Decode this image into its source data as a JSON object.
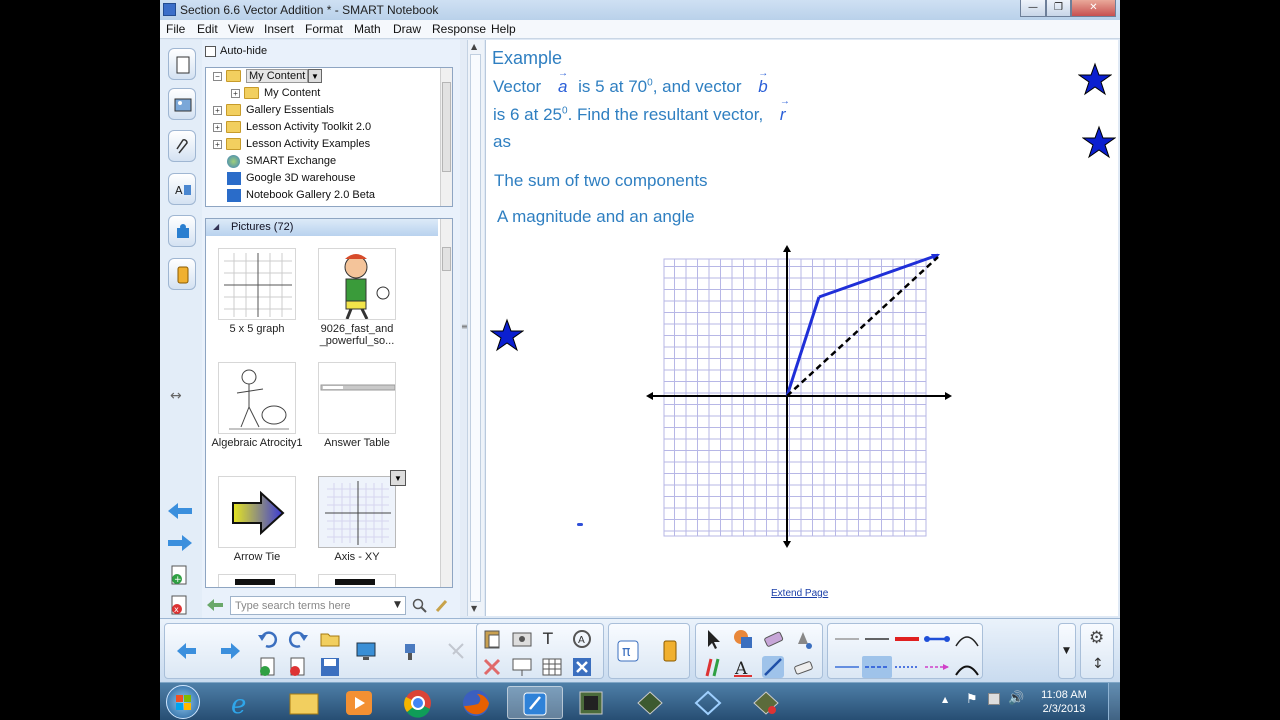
{
  "window": {
    "title": "Section 6.6 Vector Addition * - SMART Notebook",
    "minimize": "—",
    "maximize": "❐",
    "close": "✕"
  },
  "menu": [
    "File",
    "Edit",
    "View",
    "Insert",
    "Format",
    "Math",
    "Draw",
    "Response",
    "Help"
  ],
  "gallery": {
    "autohide_label": "Auto-hide",
    "tree": [
      {
        "label": "My Content",
        "level": 0,
        "expander": "−",
        "selected": true
      },
      {
        "label": "My Content",
        "level": 1,
        "expander": "+"
      },
      {
        "label": "Gallery Essentials",
        "level": 0,
        "expander": "+"
      },
      {
        "label": "Lesson Activity Toolkit 2.0",
        "level": 0,
        "expander": "+"
      },
      {
        "label": "Lesson Activity Examples",
        "level": 0,
        "expander": "+"
      },
      {
        "label": "SMART Exchange",
        "level": 0,
        "expander": ""
      },
      {
        "label": "Google 3D warehouse",
        "level": 0,
        "expander": ""
      },
      {
        "label": "Notebook Gallery 2.0 Beta",
        "level": 0,
        "expander": ""
      }
    ],
    "pictures_header": "Pictures (72)",
    "thumbnails": [
      {
        "caption": "5 x 5 graph"
      },
      {
        "caption": "9026_fast_and _powerful_so..."
      },
      {
        "caption": "Algebraic Atrocity1"
      },
      {
        "caption": "Answer Table"
      },
      {
        "caption": "Arrow Tie"
      },
      {
        "caption": "Axis - XY"
      }
    ],
    "search_placeholder": "Type search terms here"
  },
  "page": {
    "heading": "Example",
    "line1_a": "Vector",
    "var_a": "a",
    "line1_b": "is 5 at 70",
    "line1_c": ", and vector",
    "var_b": "b",
    "line2_a": "is 6 at 25",
    "line2_b": ".  Find the resultant vector,",
    "var_r": "r",
    "degree": "0",
    "line3": "as",
    "option1": "The sum of two components",
    "option2": "A magnitude and an angle",
    "extend": "Extend Page"
  },
  "taskbar": {
    "time": "11:08 AM",
    "date": "2/3/2013"
  },
  "colors": {
    "text_blue": "#2f7fc1",
    "grid": "#b7b7e6",
    "vector": "#1f2fd8",
    "star": "#0b1fd0"
  }
}
